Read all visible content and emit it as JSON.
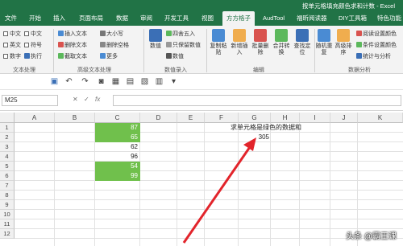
{
  "window": {
    "title": "按单元格填充颜色求和计数 - Excel"
  },
  "tabs": [
    "文件",
    "开始",
    "插入",
    "页面布局",
    "数据",
    "审阅",
    "开发工具",
    "视图",
    "方方格子",
    "AudTool",
    "福昕阅读器",
    "DIY工具箱",
    "特色功能"
  ],
  "active_tab": "方方格子",
  "ribbon": {
    "text_group": {
      "items": [
        "中文",
        "英文",
        "数字",
        "中文",
        "符号",
        "执行"
      ],
      "label": "文本处理"
    },
    "advanced_text": {
      "items": [
        "插入文本",
        "删除文本",
        "截取文本",
        "大小写",
        "删除空格",
        "更多"
      ],
      "label": "高级文本处理"
    },
    "number_group": {
      "items": [
        "数值",
        "四舍五入",
        "只保留数值",
        "数值"
      ],
      "label": "数值录入"
    },
    "edit_group": {
      "items": [
        "复制粘贴",
        "新增插入",
        "批量删除",
        "合并转换",
        "查找定位"
      ],
      "label": "编辑"
    },
    "analysis_group": {
      "items": [
        "随机重复",
        "高级排序",
        "阅读设置颜色",
        "条件设置颜色",
        "统计与分析"
      ],
      "label": "数据分析"
    }
  },
  "formula_bar": {
    "name_box": "M25",
    "fx": "fx"
  },
  "columns": [
    "A",
    "B",
    "C",
    "D",
    "E",
    "F",
    "G",
    "H",
    "I",
    "J",
    "K"
  ],
  "rows": [
    "1",
    "2",
    "3",
    "4",
    "5",
    "6",
    "7",
    "8",
    "9",
    "10",
    "11",
    "12"
  ],
  "cells": {
    "c_values": [
      "87",
      "65",
      "62",
      "96",
      "54",
      "99"
    ],
    "c_green": [
      true,
      true,
      false,
      false,
      true,
      true
    ],
    "question": "求单元格是绿色的数据和",
    "answer": "305"
  },
  "colors": {
    "excel_green": "#217346",
    "cell_green": "#70c04c",
    "arrow_red": "#e2242b"
  },
  "watermark": "头条 @霸王课"
}
